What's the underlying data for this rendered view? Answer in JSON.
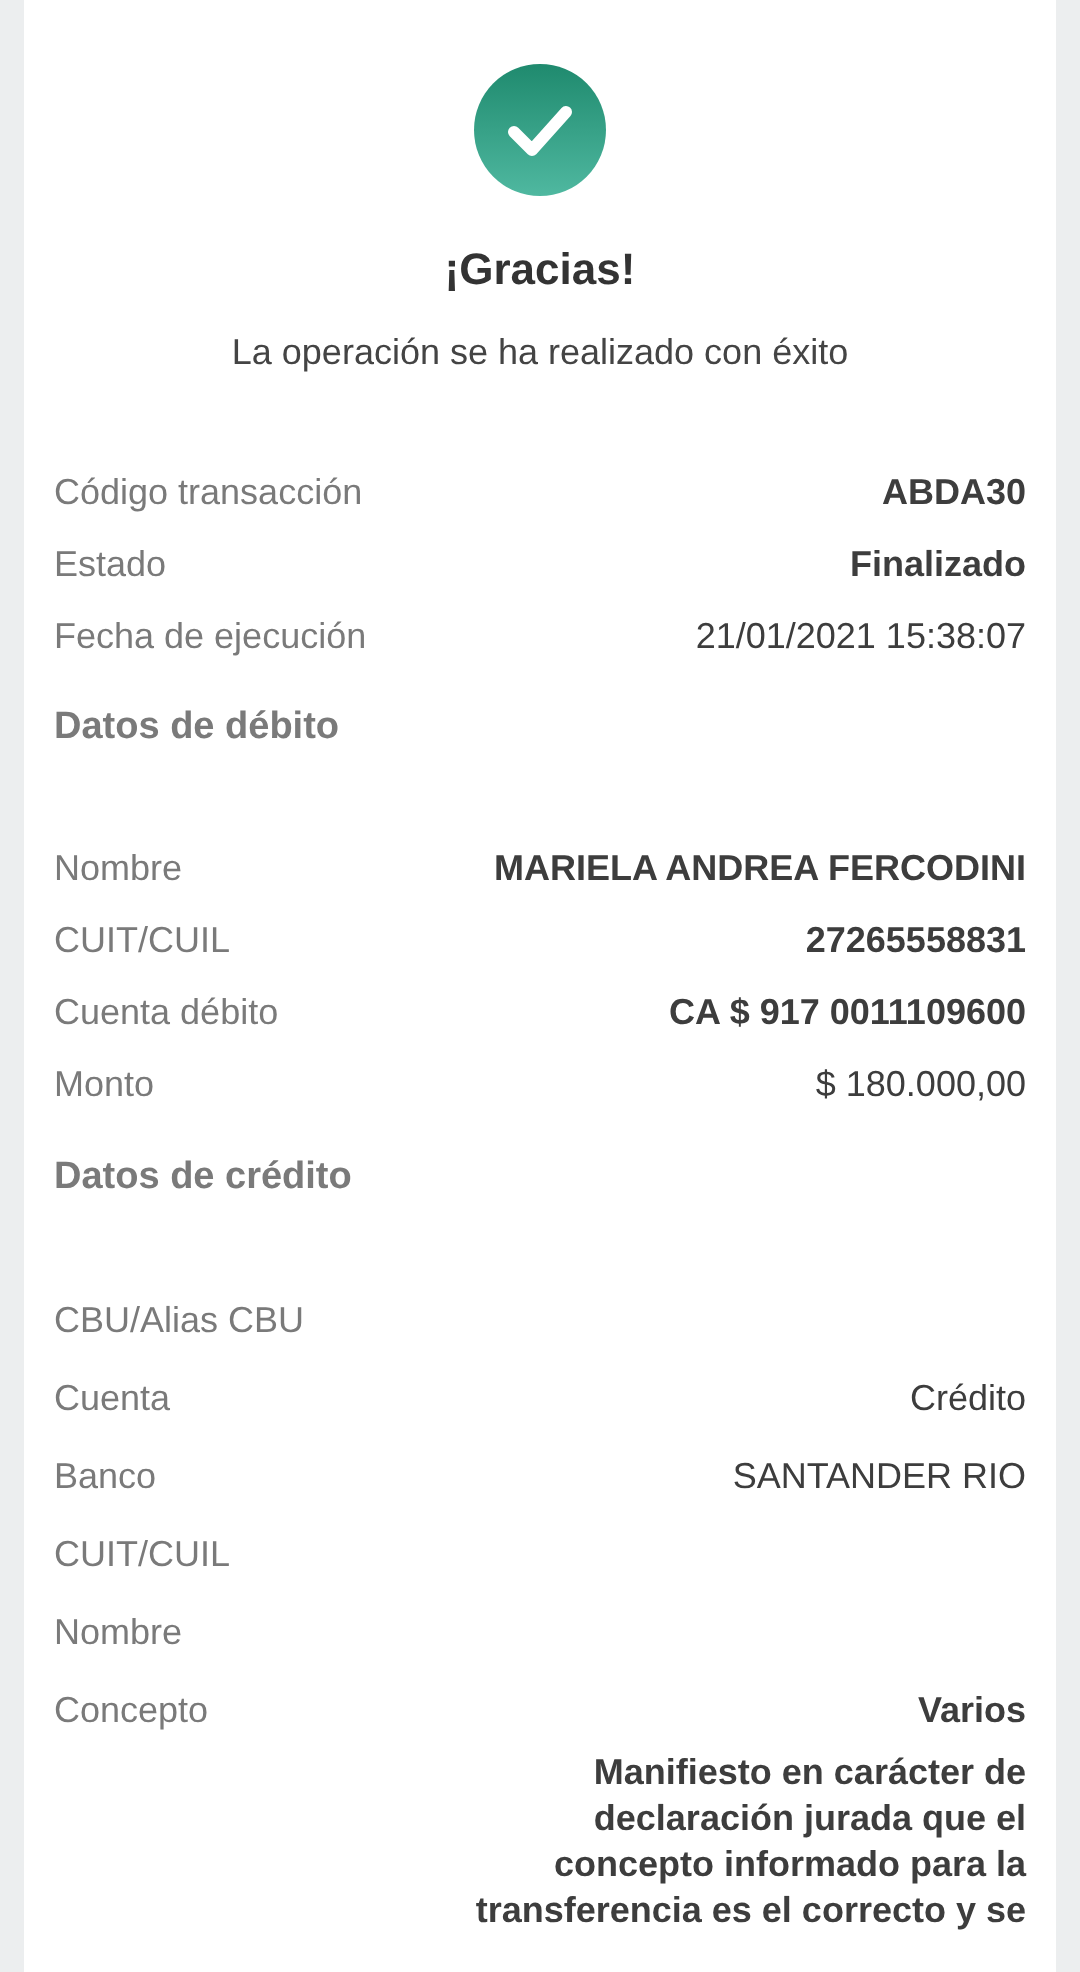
{
  "header": {
    "title": "¡Gracias!",
    "message": "La operación se ha realizado con éxito"
  },
  "summary": [
    {
      "label": "Código transacción",
      "value": "ABDA30",
      "bold": true
    },
    {
      "label": "Estado",
      "value": "Finalizado",
      "bold": true
    },
    {
      "label": "Fecha de ejecución",
      "value": "21/01/2021 15:38:07",
      "bold": false
    }
  ],
  "sections": [
    {
      "title": "Datos de débito",
      "rows": [
        {
          "label": "Nombre",
          "value": "MARIELA ANDREA FERCODINI",
          "bold": true
        },
        {
          "label": "CUIT/CUIL",
          "value": "27265558831",
          "bold": true
        },
        {
          "label": "Cuenta débito",
          "value": "CA $ 917 0011109600",
          "bold": true
        },
        {
          "label": "Monto",
          "value": "$ 180.000,00",
          "bold": false
        }
      ]
    },
    {
      "title": "Datos de crédito",
      "rows": [
        {
          "label": "CBU/Alias CBU"
        },
        {
          "label": "Cuenta",
          "value": "Crédito",
          "bold": false
        },
        {
          "label": "Banco",
          "value": "SANTANDER RIO",
          "bold": false
        },
        {
          "label": "CUIT/CUIL"
        },
        {
          "label": "Nombre"
        },
        {
          "label": "Concepto",
          "value": "Varios",
          "bold": true
        }
      ]
    }
  ],
  "declaration": "Manifiesto en carácter de declaración jurada que el concepto informado para la transferencia es el correcto y se"
}
